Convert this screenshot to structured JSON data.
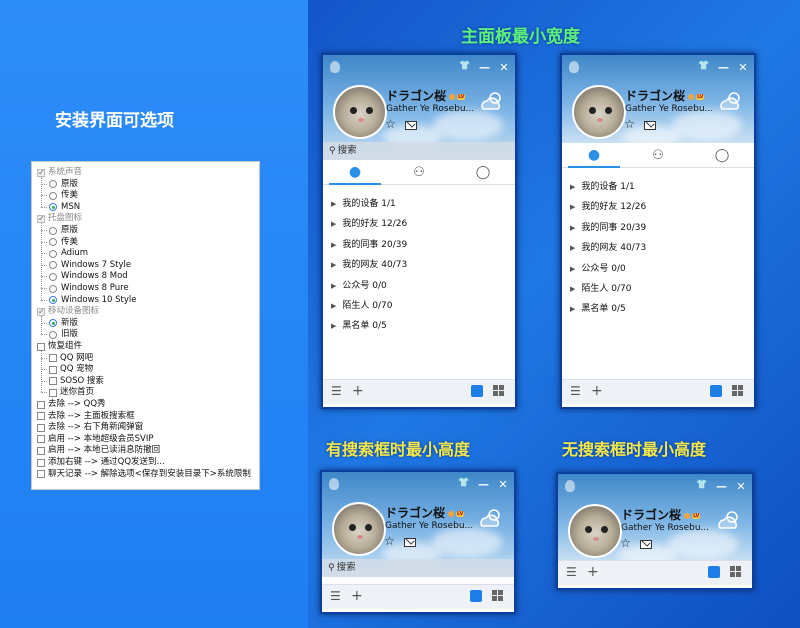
{
  "left_title": "安装界面可选项",
  "options": [
    {
      "type": "checkbox",
      "label": "系统声音",
      "checked": true,
      "disabled": true,
      "level": 0
    },
    {
      "type": "radio",
      "label": "原版",
      "checked": false,
      "level": 1
    },
    {
      "type": "radio",
      "label": "传美",
      "checked": false,
      "level": 1
    },
    {
      "type": "radio",
      "label": "MSN",
      "checked": true,
      "level": 1
    },
    {
      "type": "checkbox",
      "label": "托盘图标",
      "checked": true,
      "disabled": true,
      "level": 0
    },
    {
      "type": "radio",
      "label": "原版",
      "checked": false,
      "level": 1
    },
    {
      "type": "radio",
      "label": "传美",
      "checked": false,
      "level": 1
    },
    {
      "type": "radio",
      "label": "Adium",
      "checked": false,
      "level": 1
    },
    {
      "type": "radio",
      "label": "Windows 7 Style",
      "checked": false,
      "level": 1
    },
    {
      "type": "radio",
      "label": "Windows 8 Mod",
      "checked": false,
      "level": 1
    },
    {
      "type": "radio",
      "label": "Windows 8 Pure",
      "checked": false,
      "level": 1
    },
    {
      "type": "radio",
      "label": "Windows 10 Style",
      "checked": true,
      "level": 1
    },
    {
      "type": "checkbox",
      "label": "移动设备图标",
      "checked": true,
      "disabled": true,
      "level": 0
    },
    {
      "type": "radio",
      "label": "新版",
      "checked": true,
      "level": 1
    },
    {
      "type": "radio",
      "label": "旧版",
      "checked": false,
      "level": 1
    },
    {
      "type": "checkbox",
      "label": "恢复组件",
      "checked": false,
      "level": 0
    },
    {
      "type": "checkbox",
      "label": "QQ 网吧",
      "checked": false,
      "level": 1
    },
    {
      "type": "checkbox",
      "label": "QQ 宠物",
      "checked": false,
      "level": 1
    },
    {
      "type": "checkbox",
      "label": "SOSO 搜索",
      "checked": false,
      "level": 1
    },
    {
      "type": "checkbox",
      "label": "迷你首页",
      "checked": false,
      "level": 1
    },
    {
      "type": "checkbox",
      "label": "去除 --> QQ秀",
      "checked": false,
      "level": 0
    },
    {
      "type": "checkbox",
      "label": "去除 --> 主面板搜索框",
      "checked": false,
      "level": 0
    },
    {
      "type": "checkbox",
      "label": "去除 --> 右下角新闻弹窗",
      "checked": false,
      "level": 0
    },
    {
      "type": "checkbox",
      "label": "启用 --> 本地超级会员SVIP",
      "checked": false,
      "level": 0
    },
    {
      "type": "checkbox",
      "label": "启用 --> 本地已读消息防撤回",
      "checked": false,
      "level": 0
    },
    {
      "type": "checkbox",
      "label": "添加右键 --> 通过QQ发送到...",
      "checked": false,
      "level": 0
    },
    {
      "type": "checkbox",
      "label": "聊天记录 --> 解除选项<保存到安装目录下>系统限制",
      "checked": false,
      "level": 0
    }
  ],
  "headings": {
    "main_min_width": "主面板最小宽度",
    "min_height_with_search": "有搜索框时最小高度",
    "min_height_without_search": "无搜索框时最小高度"
  },
  "profile": {
    "nickname": "ドラゴン桜",
    "level_badge": "LV",
    "signature_short": "Gather Ye Rosebu...",
    "search_placeholder": "搜索"
  },
  "groups": [
    {
      "name": "我的设备",
      "count": "1/1"
    },
    {
      "name": "我的好友",
      "count": "12/26"
    },
    {
      "name": "我的同事",
      "count": "20/39"
    },
    {
      "name": "我的网友",
      "count": "40/73"
    },
    {
      "name": "公众号",
      "count": "0/0"
    },
    {
      "name": "陌生人",
      "count": "0/70"
    },
    {
      "name": "黑名单",
      "count": "0/5"
    }
  ],
  "colors": {
    "accent": "#2a8fe6",
    "heading_green": "#5df07c",
    "heading_yellow": "#f4e84a"
  }
}
